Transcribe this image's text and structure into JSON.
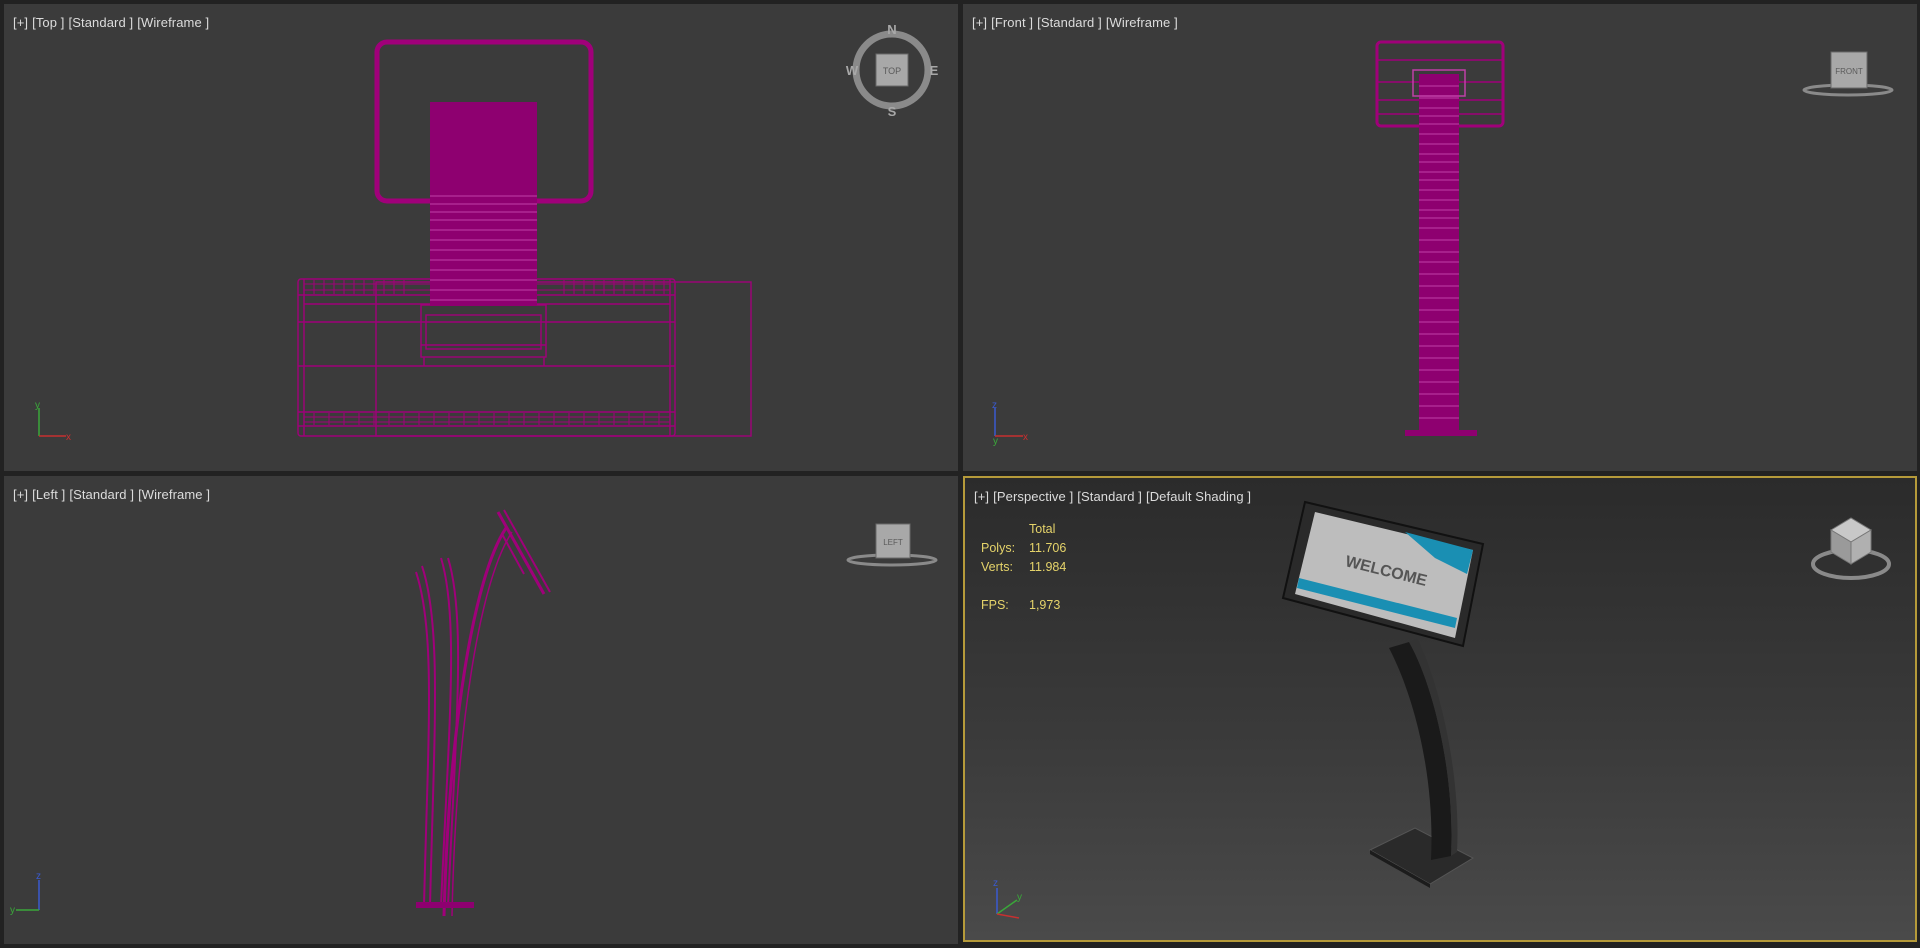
{
  "viewports": {
    "top": {
      "labels": [
        "[+]",
        "[Top ]",
        "[Standard ]",
        "[Wireframe ]"
      ],
      "cube": "TOP",
      "compass": {
        "n": "N",
        "s": "S",
        "e": "E",
        "w": "W"
      },
      "axes": {
        "a": "y",
        "b": "x"
      }
    },
    "front": {
      "labels": [
        "[+]",
        "[Front ]",
        "[Standard ]",
        "[Wireframe ]"
      ],
      "cube": "FRONT",
      "axes": {
        "a": "z",
        "b": "x"
      }
    },
    "left": {
      "labels": [
        "[+]",
        "[Left ]",
        "[Standard ]",
        "[Wireframe ]"
      ],
      "cube": "LEFT",
      "axes": {
        "a": "z",
        "b": "y"
      }
    },
    "perspective": {
      "labels": [
        "[+]",
        "[Perspective ]",
        "[Standard ]",
        "[Default Shading ]"
      ],
      "axes": {
        "a": "z",
        "b": "y"
      },
      "stats": {
        "header": "Total",
        "polys_label": "Polys:",
        "polys": "11.706",
        "verts_label": "Verts:",
        "verts": "11.984",
        "fps_label": "FPS:",
        "fps": "1,973"
      },
      "screen_text": "WELCOME"
    }
  },
  "colors": {
    "wire": "#a0007a",
    "active_border": "#b59a3a",
    "stats": "#e5d36a"
  }
}
